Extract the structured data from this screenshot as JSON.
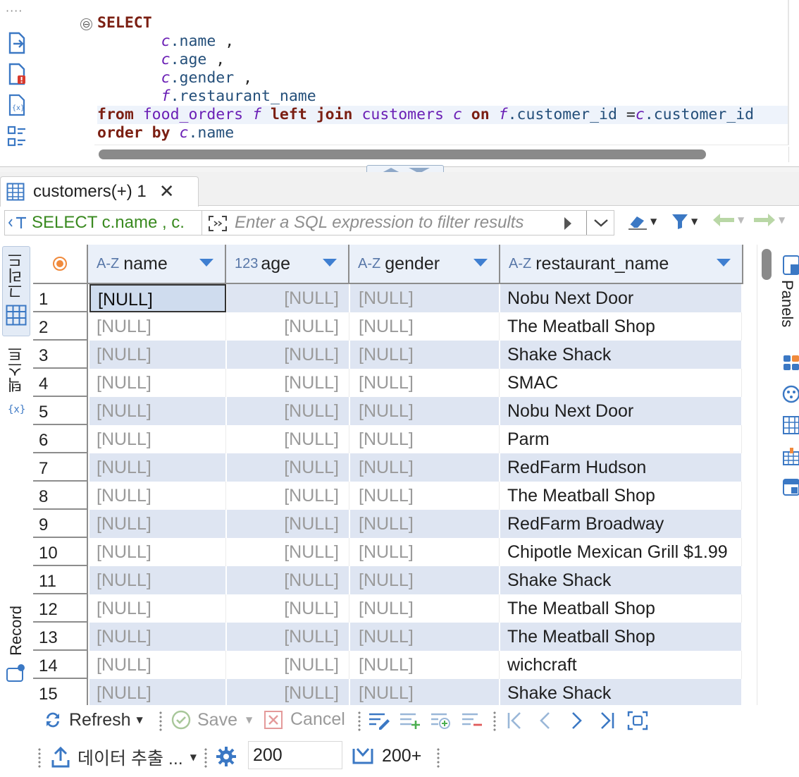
{
  "editor": {
    "gutter_dots": "····",
    "fold_symbol": "⊖",
    "lines": [
      [
        {
          "t": "kw",
          "v": "SELECT"
        }
      ],
      [
        {
          "t": "plain",
          "v": "       "
        },
        {
          "t": "alias",
          "v": "c"
        },
        {
          "t": "ident",
          "v": ".name"
        },
        {
          "t": "plain",
          "v": " ,"
        }
      ],
      [
        {
          "t": "plain",
          "v": "       "
        },
        {
          "t": "alias",
          "v": "c"
        },
        {
          "t": "ident",
          "v": ".age"
        },
        {
          "t": "plain",
          "v": " ,"
        }
      ],
      [
        {
          "t": "plain",
          "v": "       "
        },
        {
          "t": "alias",
          "v": "c"
        },
        {
          "t": "ident",
          "v": ".gender"
        },
        {
          "t": "plain",
          "v": " ,"
        }
      ],
      [
        {
          "t": "plain",
          "v": "       "
        },
        {
          "t": "alias",
          "v": "f"
        },
        {
          "t": "ident",
          "v": ".restaurant_name"
        }
      ],
      [
        {
          "t": "kw",
          "v": "from"
        },
        {
          "t": "plain",
          "v": " "
        },
        {
          "t": "tbl",
          "v": "food_orders"
        },
        {
          "t": "plain",
          "v": " "
        },
        {
          "t": "alias",
          "v": "f"
        },
        {
          "t": "plain",
          "v": " "
        },
        {
          "t": "kw",
          "v": "left join"
        },
        {
          "t": "plain",
          "v": " "
        },
        {
          "t": "tbl",
          "v": "customers"
        },
        {
          "t": "plain",
          "v": " "
        },
        {
          "t": "alias",
          "v": "c"
        },
        {
          "t": "plain",
          "v": " "
        },
        {
          "t": "kw",
          "v": "on"
        },
        {
          "t": "plain",
          "v": " "
        },
        {
          "t": "alias",
          "v": "f"
        },
        {
          "t": "ident",
          "v": ".customer_id"
        },
        {
          "t": "plain",
          "v": " ="
        },
        {
          "t": "alias",
          "v": "c"
        },
        {
          "t": "ident",
          "v": ".customer_id"
        }
      ],
      [
        {
          "t": "kw",
          "v": "order by"
        },
        {
          "t": "plain",
          "v": " "
        },
        {
          "t": "alias",
          "v": "c"
        },
        {
          "t": "ident",
          "v": ".name"
        }
      ]
    ],
    "current_line_index": 5
  },
  "result_tab": {
    "label": "customers(+) 1",
    "close": "✕"
  },
  "filter_bar": {
    "query_preview": "SELECT c.name , c.",
    "filter_placeholder": "Enter a SQL expression to filter results"
  },
  "left_tabs": {
    "grid": "그리드",
    "text": "텍스트",
    "record": "Record"
  },
  "right_tabs": {
    "panels": "Panels"
  },
  "grid": {
    "columns": [
      {
        "type": "A-Z",
        "name": "name"
      },
      {
        "type": "123",
        "name": "age"
      },
      {
        "type": "A-Z",
        "name": "gender"
      },
      {
        "type": "A-Z",
        "name": "restaurant_name"
      }
    ],
    "rows": [
      {
        "n": "1",
        "name": "[NULL]",
        "age": "[NULL]",
        "gender": "[NULL]",
        "restaurant": "Nobu Next Door"
      },
      {
        "n": "2",
        "name": "[NULL]",
        "age": "[NULL]",
        "gender": "[NULL]",
        "restaurant": "The Meatball Shop"
      },
      {
        "n": "3",
        "name": "[NULL]",
        "age": "[NULL]",
        "gender": "[NULL]",
        "restaurant": "Shake Shack"
      },
      {
        "n": "4",
        "name": "[NULL]",
        "age": "[NULL]",
        "gender": "[NULL]",
        "restaurant": "SMAC"
      },
      {
        "n": "5",
        "name": "[NULL]",
        "age": "[NULL]",
        "gender": "[NULL]",
        "restaurant": "Nobu Next Door"
      },
      {
        "n": "6",
        "name": "[NULL]",
        "age": "[NULL]",
        "gender": "[NULL]",
        "restaurant": "Parm"
      },
      {
        "n": "7",
        "name": "[NULL]",
        "age": "[NULL]",
        "gender": "[NULL]",
        "restaurant": "RedFarm Hudson"
      },
      {
        "n": "8",
        "name": "[NULL]",
        "age": "[NULL]",
        "gender": "[NULL]",
        "restaurant": "The Meatball Shop"
      },
      {
        "n": "9",
        "name": "[NULL]",
        "age": "[NULL]",
        "gender": "[NULL]",
        "restaurant": "RedFarm Broadway"
      },
      {
        "n": "10",
        "name": "[NULL]",
        "age": "[NULL]",
        "gender": "[NULL]",
        "restaurant": "Chipotle Mexican Grill $1.99"
      },
      {
        "n": "11",
        "name": "[NULL]",
        "age": "[NULL]",
        "gender": "[NULL]",
        "restaurant": "Shake Shack"
      },
      {
        "n": "12",
        "name": "[NULL]",
        "age": "[NULL]",
        "gender": "[NULL]",
        "restaurant": "The Meatball Shop"
      },
      {
        "n": "13",
        "name": "[NULL]",
        "age": "[NULL]",
        "gender": "[NULL]",
        "restaurant": "The Meatball Shop"
      },
      {
        "n": "14",
        "name": "[NULL]",
        "age": "[NULL]",
        "gender": "[NULL]",
        "restaurant": "wichcraft"
      },
      {
        "n": "15",
        "name": "[NULL]",
        "age": "[NULL]",
        "gender": "[NULL]",
        "restaurant": "Shake Shack"
      }
    ]
  },
  "toolbar": {
    "refresh": "Refresh",
    "save": "Save",
    "cancel": "Cancel",
    "export": "데이터 추출 ...",
    "fetch_size": "200",
    "fetch_more": "200+"
  },
  "colors": {
    "accent": "#3f7fd1",
    "row_stripe": "#dee5f2",
    "keyword": "#7b1f12",
    "alias": "#6a1fb5",
    "query_green": "#3a8a20"
  }
}
